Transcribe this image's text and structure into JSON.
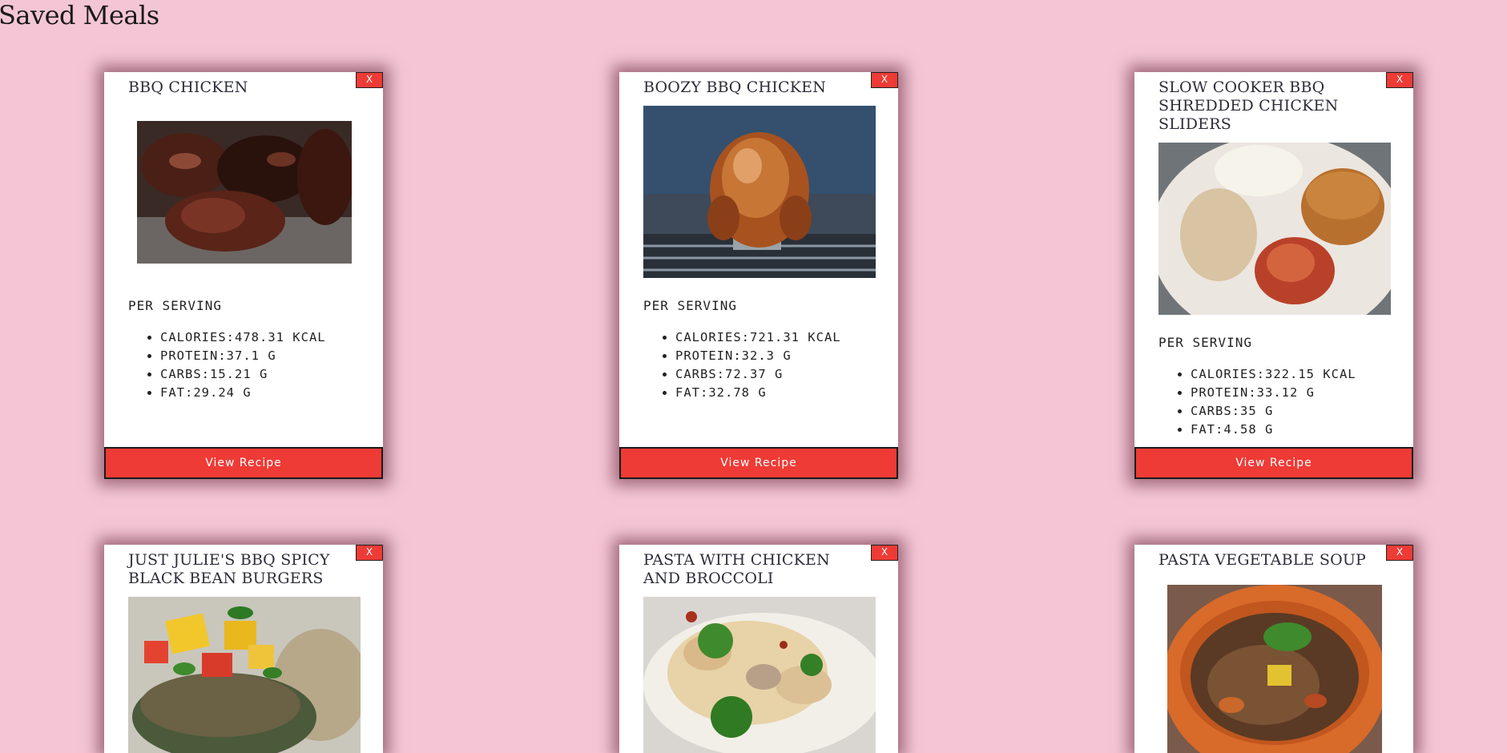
{
  "page": {
    "title": "Saved Meals"
  },
  "close_label": "X",
  "serving_label": "PER SERVING",
  "view_recipe_label": "View Recipe",
  "colors": {
    "background": "#f4c6d5",
    "accent": "#ee3b36",
    "card": "#ffffff"
  },
  "meals": [
    {
      "title": "BBQ CHICKEN",
      "nutrients": [
        "CALORIES:478.31 KCAL",
        "PROTEIN:37.1 G",
        "CARBS:15.21 G",
        "FAT:29.24 G"
      ]
    },
    {
      "title": "BOOZY BBQ CHICKEN",
      "nutrients": [
        "CALORIES:721.31 KCAL",
        "PROTEIN:32.3 G",
        "CARBS:72.37 G",
        "FAT:32.78 G"
      ]
    },
    {
      "title": "SLOW COOKER BBQ SHREDDED CHICKEN SLIDERS",
      "nutrients": [
        "CALORIES:322.15 KCAL",
        "PROTEIN:33.12 G",
        "CARBS:35 G",
        "FAT:4.58 G"
      ]
    },
    {
      "title": "JUST JULIE'S BBQ SPICY BLACK BEAN BURGERS"
    },
    {
      "title": "PASTA WITH CHICKEN AND BROCCOLI"
    },
    {
      "title": "PASTA VEGETABLE SOUP"
    }
  ]
}
